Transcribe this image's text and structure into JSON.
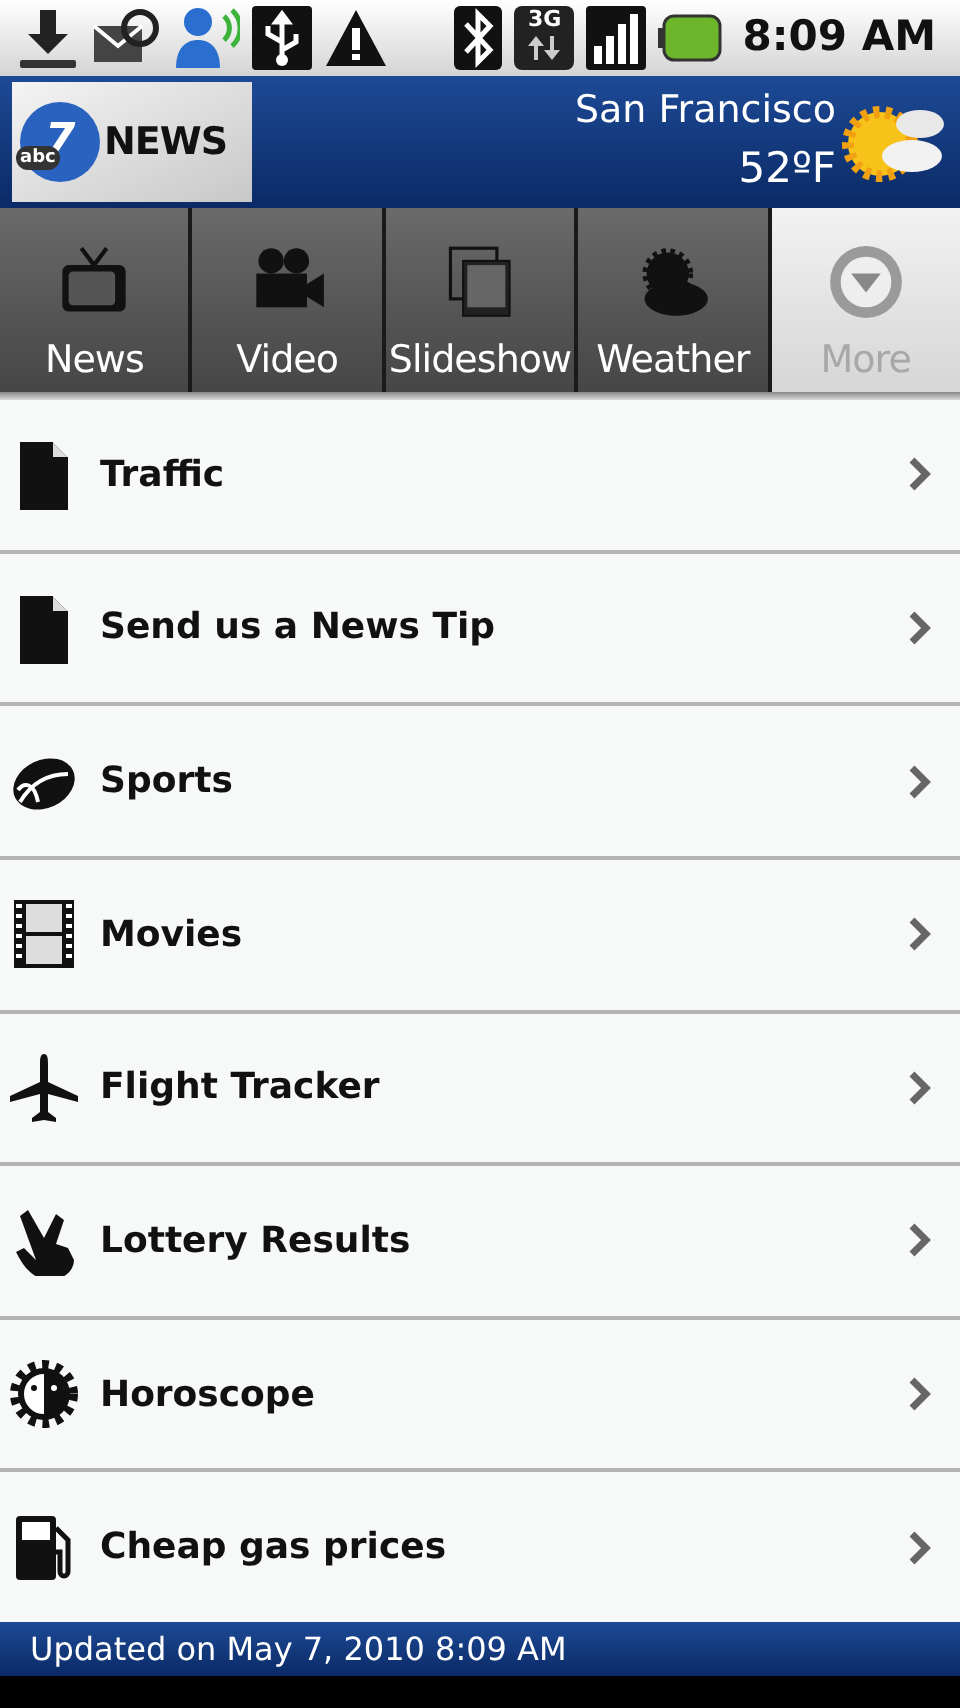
{
  "status_bar": {
    "network": "3G",
    "time": "8:09 AM"
  },
  "header": {
    "logo": {
      "network": "abc",
      "channel": "7",
      "name": "NEWS"
    },
    "city": "San Francisco",
    "temperature": "52ºF"
  },
  "tabs": [
    {
      "label": "News",
      "kind": "tv",
      "selected": false
    },
    {
      "label": "Video",
      "kind": "camera",
      "selected": false
    },
    {
      "label": "Slideshow",
      "kind": "slides",
      "selected": false
    },
    {
      "label": "Weather",
      "kind": "weather",
      "selected": false
    },
    {
      "label": "More",
      "kind": "more",
      "selected": true
    }
  ],
  "items": [
    {
      "label": "Traffic",
      "kind": "document"
    },
    {
      "label": "Send us a News Tip",
      "kind": "document"
    },
    {
      "label": "Sports",
      "kind": "football"
    },
    {
      "label": "Movies",
      "kind": "film"
    },
    {
      "label": "Flight Tracker",
      "kind": "plane"
    },
    {
      "label": "Lottery Results",
      "kind": "fingers"
    },
    {
      "label": "Horoscope",
      "kind": "sun"
    },
    {
      "label": "Cheap gas prices",
      "kind": "fuel"
    }
  ],
  "footer": "Updated on May 7, 2010 8:09 AM"
}
